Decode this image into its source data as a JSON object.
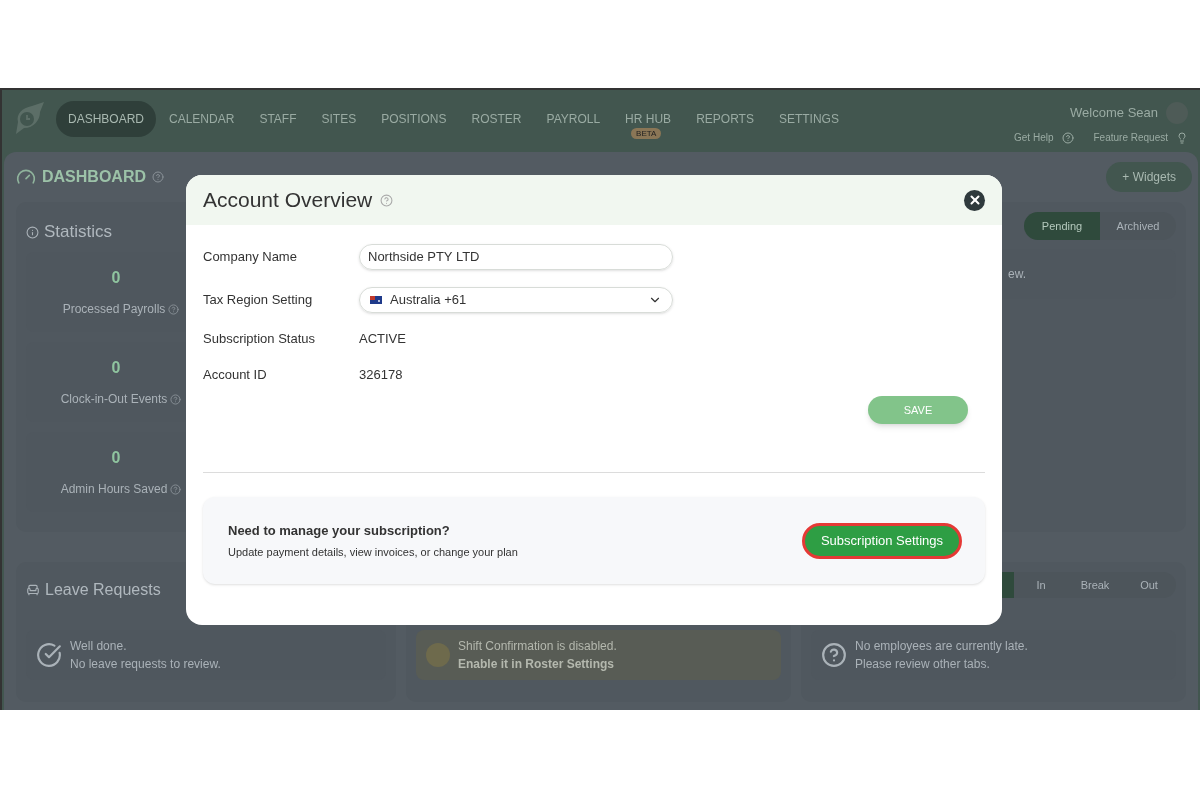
{
  "nav": {
    "items": [
      {
        "label": "DASHBOARD",
        "selected": true
      },
      {
        "label": "CALENDAR",
        "selected": false
      },
      {
        "label": "STAFF",
        "selected": false
      },
      {
        "label": "SITES",
        "selected": false
      },
      {
        "label": "POSITIONS",
        "selected": false
      },
      {
        "label": "ROSTER",
        "selected": false
      },
      {
        "label": "PAYROLL",
        "selected": false
      },
      {
        "label": "HR HUB",
        "selected": false,
        "badge": "BETA"
      },
      {
        "label": "REPORTS",
        "selected": false
      },
      {
        "label": "SETTINGS",
        "selected": false
      }
    ],
    "welcome": "Welcome Sean",
    "help": "Get Help",
    "feature": "Feature Request"
  },
  "dashboard": {
    "title": "DASHBOARD",
    "widgets_button": "+ Widgets"
  },
  "statistics": {
    "title": "Statistics",
    "items": [
      {
        "value": "0",
        "label": "Processed Payrolls"
      },
      {
        "value": "0",
        "label": "Clock-in-Out Events"
      },
      {
        "value": "0",
        "label": "Admin Hours Saved"
      }
    ]
  },
  "approvals": {
    "tabs": [
      {
        "label": "Pending",
        "selected": true
      },
      {
        "label": "Archived",
        "selected": false
      }
    ],
    "message": "ew."
  },
  "leave_requests": {
    "title": "Leave Requests",
    "lines": [
      "Well done.",
      "No leave requests to review."
    ]
  },
  "shift_confirmation": {
    "message": "Shift Confirmation is disabled.",
    "link": "Enable it in Roster Settings"
  },
  "late": {
    "tabs": [
      {
        "label": "In",
        "selected": false
      },
      {
        "label": "Break",
        "selected": false
      },
      {
        "label": "Out",
        "selected": false
      }
    ],
    "lines": [
      "No employees are currently late.",
      "Please review other tabs."
    ]
  },
  "modal": {
    "title": "Account Overview",
    "fields": [
      {
        "kind": "input",
        "label": "Company Name",
        "value": "Northside PTY LTD"
      },
      {
        "kind": "select",
        "label": "Tax Region Setting",
        "value": "Australia +61"
      },
      {
        "kind": "text",
        "label": "Subscription Status",
        "value": "ACTIVE"
      },
      {
        "kind": "text",
        "label": "Account ID",
        "value": "326178"
      }
    ],
    "save": "SAVE",
    "subscription": {
      "heading": "Need to manage your subscription?",
      "text": "Update payment details, view invoices, or change your plan",
      "button": "Subscription Settings"
    }
  }
}
